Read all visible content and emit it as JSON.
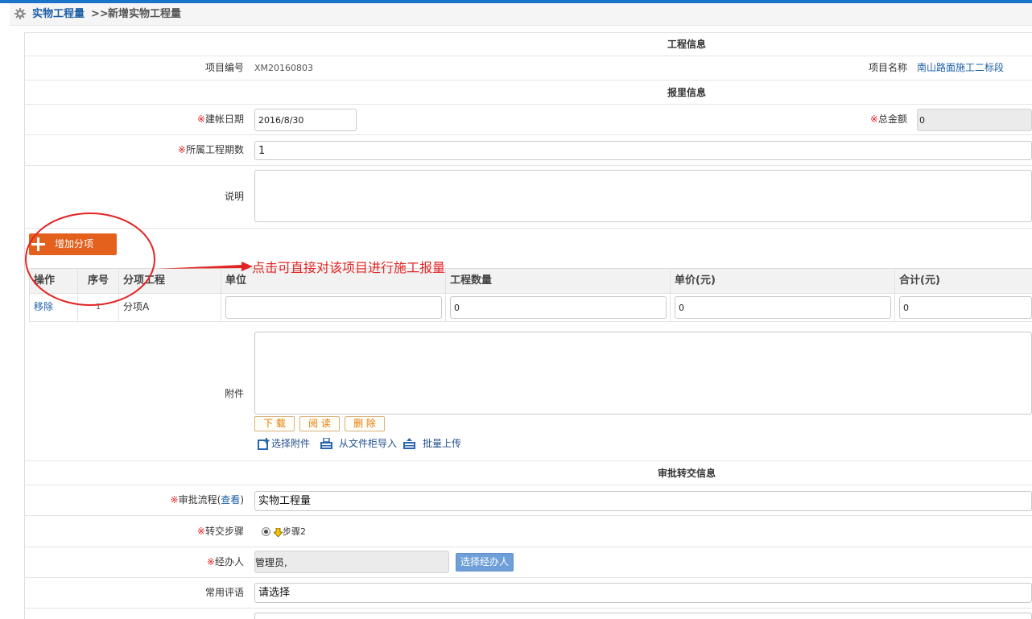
{
  "colors": {
    "top_bar": "#1a74c9",
    "link": "#1d5fa6",
    "required_mark": "#e02222",
    "add_item_button": "#e3611d",
    "attachment_button_text": "#e27b00",
    "select_handler_button": "#6e9fd9",
    "annotation": "#e32424"
  },
  "icons": {
    "breadcrumb": "gear-icon",
    "add_item": "plus-icon",
    "select_attachment": "add-file-icon",
    "import_from_cabinet": "cabinet-import-icon",
    "batch_upload": "batch-upload-icon",
    "step": "down-arrow-icon"
  },
  "required_mark": "※",
  "breadcrumb": {
    "parent": "实物工程量",
    "separator": ">>",
    "current": "新增实物工程量"
  },
  "project_info": {
    "title": "工程信息",
    "code_label": "项目编号",
    "code_value": "XM20160803",
    "name_label": "项目名称",
    "name_value": "南山路面施工二标段"
  },
  "report_info": {
    "title": "报里信息",
    "date_label": "建帐日期",
    "date_value": "2016/8/30",
    "total_label": "总金额",
    "total_value": "0",
    "period_label": "所属工程期数",
    "period_value": "1",
    "description_label": "说明",
    "description_value": ""
  },
  "add_item_button": {
    "label": "增加分项"
  },
  "annotation": {
    "text": "点击可直接对该项目进行施工报量"
  },
  "items_table": {
    "columns": [
      "操作",
      "序号",
      "分项工程",
      "单位",
      "工程数量",
      "单价(元)",
      "合计(元)"
    ],
    "rows": [
      {
        "action": "移除",
        "index": "1",
        "name": "分项A",
        "unit": "",
        "quantity": "0",
        "unit_price": "0",
        "total": "0"
      }
    ]
  },
  "attachment": {
    "label": "附件",
    "value": "",
    "buttons": {
      "download": "下 载",
      "read": "阅 读",
      "delete": "删 除"
    },
    "links": {
      "select": "选择附件",
      "import": "从文件柜导入",
      "batch_upload": "批量上传"
    }
  },
  "approval": {
    "title": "审批转交信息",
    "flow_label": "审批流程",
    "flow_view_open": "(",
    "flow_view_link": "查看",
    "flow_view_close": ")",
    "flow_value": "实物工程量",
    "step_label": "转交步骤",
    "step_option": "步骤2",
    "step_selected": true,
    "handler_label": "经办人",
    "handler_value": "管理员,",
    "handler_button": "选择经办人",
    "comment_label": "常用评语",
    "comment_value": "请选择"
  }
}
